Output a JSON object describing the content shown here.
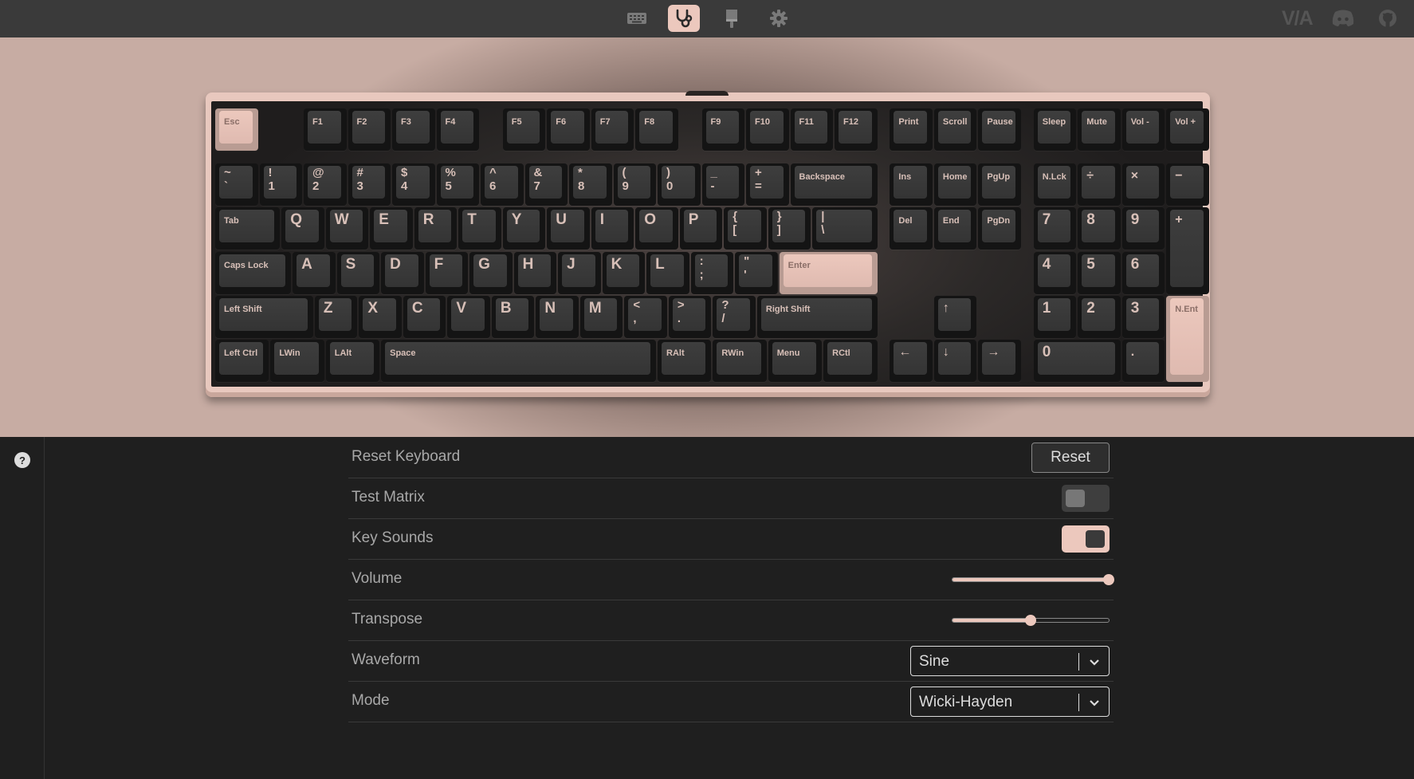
{
  "nav": {
    "tabs": [
      {
        "name": "configure",
        "icon": "keyboard-icon",
        "active": false
      },
      {
        "name": "test",
        "icon": "stethoscope-icon",
        "active": true
      },
      {
        "name": "design",
        "icon": "paintbrush-icon",
        "active": false
      },
      {
        "name": "settings",
        "icon": "gear-icon",
        "active": false
      }
    ],
    "logo_text": "V/A",
    "links": [
      "discord-icon",
      "github-icon"
    ]
  },
  "colors": {
    "accent": "#ecc8bd",
    "keycap": "#3a3a3a",
    "background": "#1f1f1f"
  },
  "keyboard": {
    "keys": {
      "esc": "Esc",
      "f1": "F1",
      "f2": "F2",
      "f3": "F3",
      "f4": "F4",
      "f5": "F5",
      "f6": "F6",
      "f7": "F7",
      "f8": "F8",
      "f9": "F9",
      "f10": "F10",
      "f11": "F11",
      "f12": "F12",
      "print": "Print",
      "scroll": "Scroll",
      "pause": "Pause",
      "sleep": "Sleep",
      "mute": "Mute",
      "vol_down": "Vol -",
      "vol_up": "Vol +",
      "grave": "~\n`",
      "k1": "!\n1",
      "k2": "@\n2",
      "k3": "#\n3",
      "k4": "$\n4",
      "k5": "%\n5",
      "k6": "^\n6",
      "k7": "&\n7",
      "k8": "*\n8",
      "k9": "(\n9",
      "k0": ")\n0",
      "minus": "_\n-",
      "equal": "+\n=",
      "backspace": "Backspace",
      "ins": "Ins",
      "home": "Home",
      "pgup": "PgUp",
      "nlck": "N.Lck",
      "div": "÷",
      "mul": "×",
      "sub": "−",
      "tab": "Tab",
      "q": "Q",
      "w": "W",
      "e": "E",
      "r": "R",
      "t": "T",
      "y": "Y",
      "u": "U",
      "i": "I",
      "o": "O",
      "p": "P",
      "lbracket": "{\n[",
      "rbracket": "}\n]",
      "backslash": "|\n\\",
      "del": "Del",
      "end": "End",
      "pgdn": "PgDn",
      "n7": "7",
      "n8": "8",
      "n9": "9",
      "nplus": "+",
      "caps": "Caps Lock",
      "a": "A",
      "s": "S",
      "d": "D",
      "f": "F",
      "g": "G",
      "h": "H",
      "j": "J",
      "k": "K",
      "l": "L",
      "semicolon": ":\n;",
      "quote": "\"\n'",
      "enter": "Enter",
      "n4": "4",
      "n5": "5",
      "n6": "6",
      "lshift": "Left Shift",
      "z": "Z",
      "x": "X",
      "c": "C",
      "v": "V",
      "b": "B",
      "n": "N",
      "m": "M",
      "comma": "<\n,",
      "period": ">\n.",
      "slash": "?\n/",
      "rshift": "Right Shift",
      "up": "↑",
      "n1": "1",
      "n2": "2",
      "n3": "3",
      "nent": "N.Ent",
      "lctrl": "Left Ctrl",
      "lwin": "LWin",
      "lalt": "LAlt",
      "space": "Space",
      "ralt": "RAlt",
      "rwin": "RWin",
      "menu": "Menu",
      "rctrl": "RCtl",
      "left": "←",
      "down": "↓",
      "right": "→",
      "n0": "0",
      "ndot": "."
    }
  },
  "settings": {
    "reset_label": "Reset Keyboard",
    "reset_button": "Reset",
    "test_matrix_label": "Test Matrix",
    "test_matrix_on": false,
    "key_sounds_label": "Key Sounds",
    "key_sounds_on": true,
    "volume_label": "Volume",
    "volume": 1.0,
    "transpose_label": "Transpose",
    "transpose": 0.5,
    "waveform_label": "Waveform",
    "waveform_value": "Sine",
    "mode_label": "Mode",
    "mode_value": "Wicki-Hayden"
  }
}
